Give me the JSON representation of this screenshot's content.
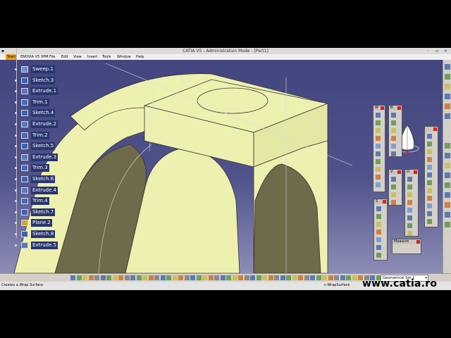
{
  "window": {
    "title": "CATIA V5 - Administration Mode - [Part1]"
  },
  "menu": {
    "start": "Start",
    "enovia": "ENOVIA V5 VPM",
    "items": [
      "File",
      "Edit",
      "View",
      "Insert",
      "Tools",
      "Window",
      "Help"
    ]
  },
  "tree": {
    "items": [
      {
        "label": "Sweep.1",
        "icon": "sweep-icon"
      },
      {
        "label": "Sketch.3",
        "icon": "sketch-icon"
      },
      {
        "label": "Extrude.1",
        "icon": "extrude-icon"
      },
      {
        "label": "Trim.1",
        "icon": "trim-icon"
      },
      {
        "label": "Sketch.4",
        "icon": "sketch-icon"
      },
      {
        "label": "Extrude.2",
        "icon": "extrude-icon"
      },
      {
        "label": "Trim.2",
        "icon": "trim-icon"
      },
      {
        "label": "Sketch.5",
        "icon": "sketch-icon"
      },
      {
        "label": "Extrude.3",
        "icon": "extrude-icon"
      },
      {
        "label": "Trim.3",
        "icon": "trim-icon"
      },
      {
        "label": "Sketch.6",
        "icon": "sketch-icon"
      },
      {
        "label": "Extrude.4",
        "icon": "extrude-icon"
      },
      {
        "label": "Trim.4",
        "icon": "trim-icon"
      },
      {
        "label": "Sketch.7",
        "icon": "sketch-icon"
      },
      {
        "label": "Plane.2",
        "icon": "plane-icon"
      },
      {
        "label": "Sketch.8",
        "icon": "sketch-icon"
      },
      {
        "label": "Extrude.5",
        "icon": "extrude-icon"
      }
    ]
  },
  "panels": {
    "w_title": "W",
    "b_title": "B",
    "v_title": "V",
    "o_title": "O",
    "s_title": "S",
    "measure_title": "Measure"
  },
  "status": {
    "left": "Creates a Wrap Surface",
    "right": "c:WrapSurface"
  },
  "geometrical_set": {
    "value": "Geometrical Set.1"
  },
  "watermark": "www.catia.ro",
  "colors": {
    "model_surface": "#eef0b0",
    "model_shadow": "#6e6a4a",
    "background_top": "#43457f",
    "background_bottom": "#8c8db5",
    "tree_highlight": "#28356e",
    "close_red": "#d62020"
  }
}
